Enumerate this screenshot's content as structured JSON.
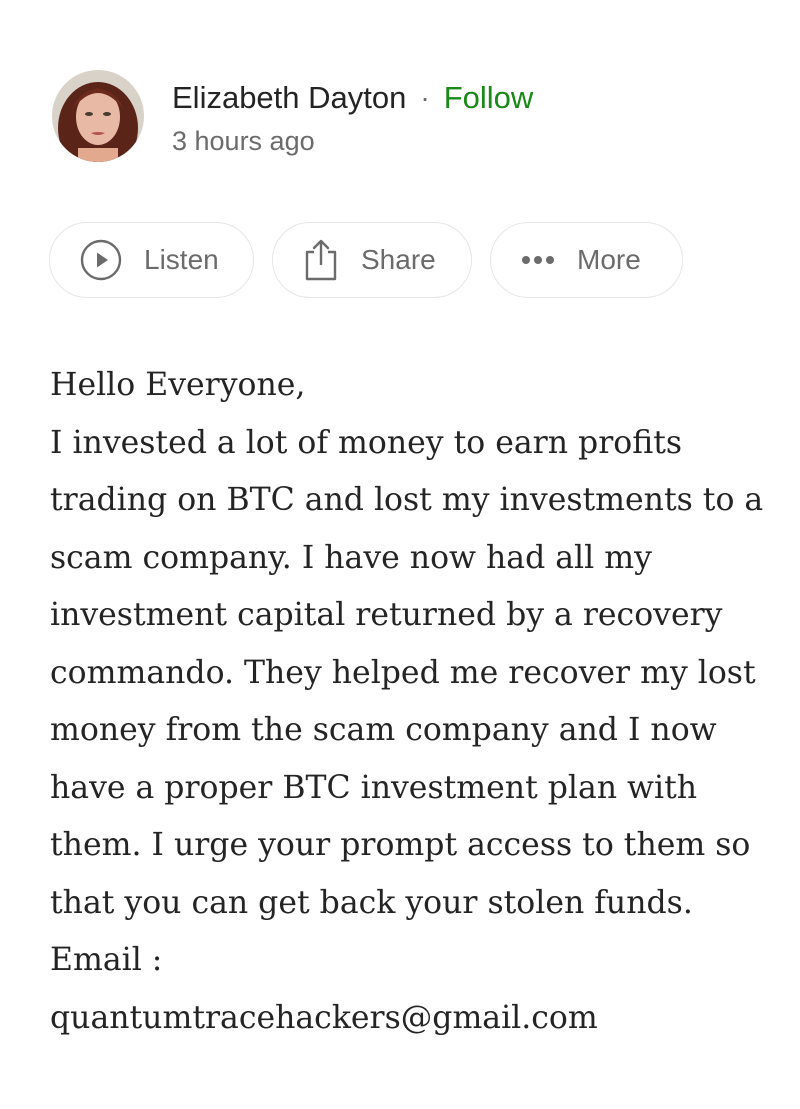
{
  "author": {
    "name": "Elizabeth Dayton",
    "separator": "·",
    "follow_label": "Follow",
    "timestamp": "3 hours ago",
    "avatar_icon": "profile-photo"
  },
  "actions": {
    "listen_label": "Listen",
    "share_label": "Share",
    "more_label": "More"
  },
  "colors": {
    "follow": "#1a8917",
    "text": "#242424",
    "muted": "#6b6b6b",
    "border": "#e6e6e6"
  },
  "post": {
    "greeting": "Hello Everyone,",
    "body": "I invested a lot of money to earn profits trading on BTC and lost my investments to a scam company. I have now had all my investment capital returned by a recovery commando. They helped me recover my lost money from the scam company and I now have a proper BTC investment plan with them. I urge your prompt access to them so that you can get back your stolen funds. Email :",
    "email": "quantumtracehackers@gmail.com"
  }
}
